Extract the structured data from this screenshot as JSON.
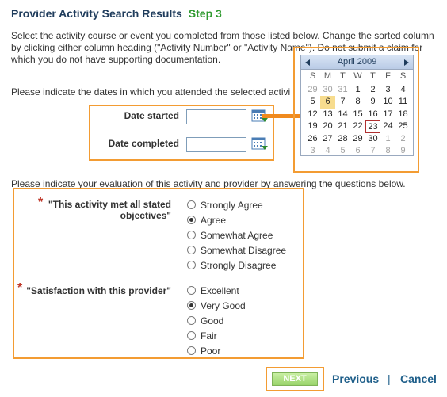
{
  "page": {
    "title": "Provider Activity Search Results",
    "step": "Step 3",
    "instructions": "Select the activity course or event you completed from those listed below. Change the sorted column by clicking either column heading (\"Activity Number\" or \"Activity Name\"). Do not submit a claim for which you do not have supporting documentation.",
    "dates_prompt": "Please indicate the dates in which you attended the selected activi",
    "evaluation_prompt": "Please indicate your evaluation of this activity and provider by answering the questions below."
  },
  "dates": {
    "started_label": "Date started",
    "started_value": "",
    "completed_label": "Date completed",
    "completed_value": ""
  },
  "calendar": {
    "month_label": "April 2009",
    "weekdays": [
      "S",
      "M",
      "T",
      "W",
      "T",
      "F",
      "S"
    ],
    "weeks": [
      [
        "29",
        "30",
        "31",
        "1",
        "2",
        "3",
        "4"
      ],
      [
        "5",
        "6",
        "7",
        "8",
        "9",
        "10",
        "11"
      ],
      [
        "12",
        "13",
        "14",
        "15",
        "16",
        "17",
        "18"
      ],
      [
        "19",
        "20",
        "21",
        "22",
        "23",
        "24",
        "25"
      ],
      [
        "26",
        "27",
        "28",
        "29",
        "30",
        "1",
        "2"
      ],
      [
        "3",
        "4",
        "5",
        "6",
        "7",
        "8",
        "9"
      ]
    ],
    "selected_day": "6",
    "today_day": "23"
  },
  "questions": [
    {
      "label": "\"This activity met all stated objectives\"",
      "required_mark": "*",
      "options": [
        "Strongly Agree",
        "Agree",
        "Somewhat Agree",
        "Somewhat Disagree",
        "Strongly Disagree"
      ],
      "selected": "Agree"
    },
    {
      "label": "\"Satisfaction with this provider\"",
      "required_mark": "*",
      "options": [
        "Excellent",
        "Very Good",
        "Good",
        "Fair",
        "Poor"
      ],
      "selected": "Very Good"
    }
  ],
  "actions": {
    "next_label": "NEXT",
    "previous_label": "Previous",
    "separator": "|",
    "cancel_label": "Cancel"
  },
  "colors": {
    "highlight": "#f39c33",
    "title": "#1f3c5c",
    "step": "#2f9a2f",
    "link": "#1f5f8a",
    "required": "#c0392b"
  }
}
